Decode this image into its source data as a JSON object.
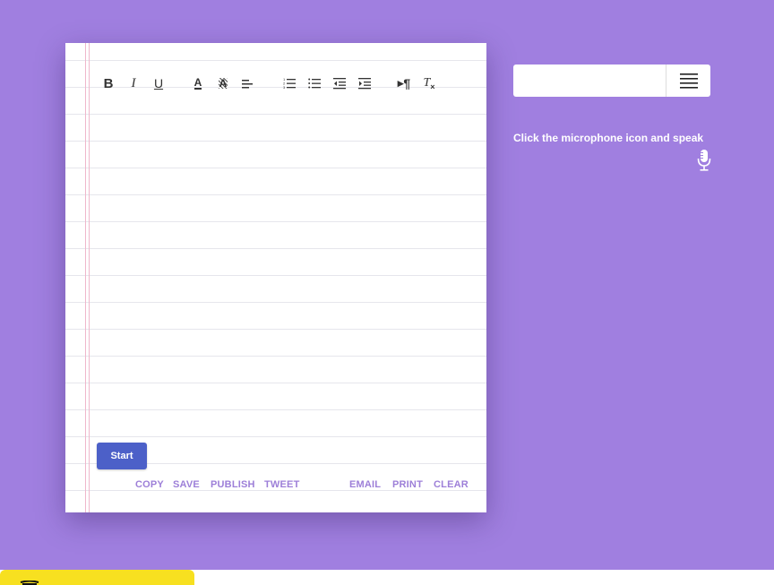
{
  "editor": {
    "toolbar": [
      {
        "name": "bold-icon",
        "glyph": "B"
      },
      {
        "name": "italic-icon",
        "glyph": "I"
      },
      {
        "name": "underline-icon",
        "glyph": "U"
      },
      {
        "name": "text-color-icon",
        "glyph": "A"
      },
      {
        "name": "highlight-color-icon",
        "glyph": "A"
      },
      {
        "name": "align-left-icon",
        "glyph": ""
      },
      {
        "name": "ordered-list-icon",
        "glyph": ""
      },
      {
        "name": "bullet-list-icon",
        "glyph": ""
      },
      {
        "name": "outdent-icon",
        "glyph": ""
      },
      {
        "name": "indent-icon",
        "glyph": ""
      },
      {
        "name": "paragraph-direction-icon",
        "glyph": "¶"
      },
      {
        "name": "clear-format-icon",
        "glyph": "T"
      }
    ],
    "start_label": "Start",
    "actions": {
      "copy": "COPY",
      "save": "SAVE",
      "publish": "PUBLISH",
      "tweet": "TWEET",
      "email": "EMAIL",
      "print": "PRINT",
      "clear": "CLEAR"
    }
  },
  "language": {
    "value": "",
    "menu_icon": "hamburger-menu-icon"
  },
  "hint": {
    "text": "Click the microphone icon and speak",
    "mic_icon": "microphone-icon"
  },
  "colors": {
    "background": "#a07fe0",
    "start_button": "#4c60c8",
    "action_text": "#9d7fd8",
    "ad_tab": "#f7e020"
  }
}
